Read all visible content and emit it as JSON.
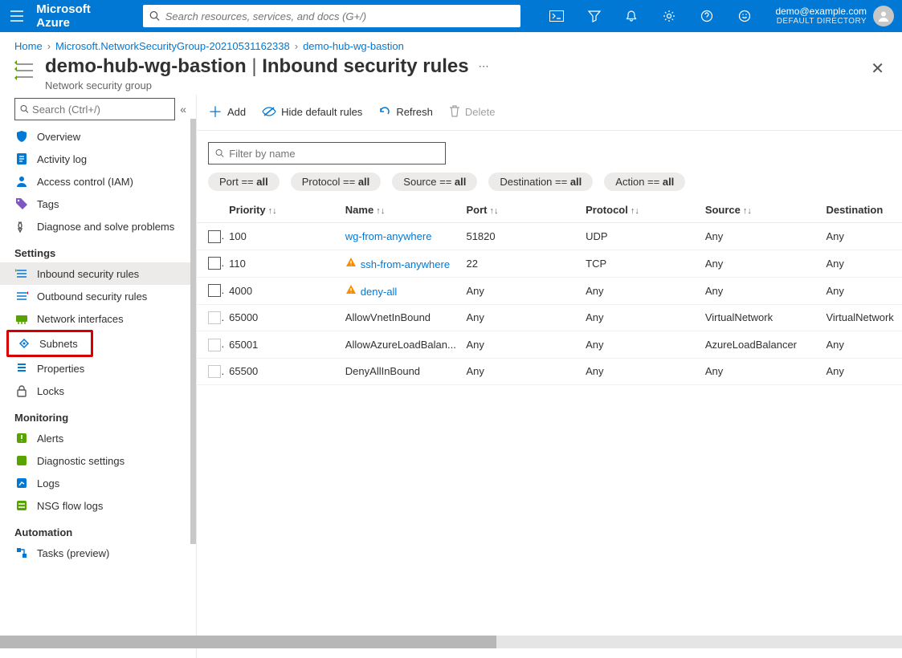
{
  "header": {
    "brand": "Microsoft Azure",
    "search_placeholder": "Search resources, services, and docs (G+/)",
    "account_email": "demo@example.com",
    "account_dir": "DEFAULT DIRECTORY"
  },
  "breadcrumb": {
    "home": "Home",
    "group": "Microsoft.NetworkSecurityGroup-20210531162338",
    "resource": "demo-hub-wg-bastion"
  },
  "page": {
    "title_left": "demo-hub-wg-bastion",
    "title_right": "Inbound security rules",
    "subtitle": "Network security group",
    "search_placeholder": "Search (Ctrl+/)"
  },
  "sidebar": {
    "items_top": [
      {
        "icon": "shield",
        "label": "Overview"
      },
      {
        "icon": "log",
        "label": "Activity log"
      },
      {
        "icon": "person",
        "label": "Access control (IAM)"
      },
      {
        "icon": "tag",
        "label": "Tags"
      },
      {
        "icon": "diag",
        "label": "Diagnose and solve problems"
      }
    ],
    "sect_settings": "Settings",
    "items_settings": [
      {
        "icon": "inbound",
        "label": "Inbound security rules",
        "active": true
      },
      {
        "icon": "outbound",
        "label": "Outbound security rules"
      },
      {
        "icon": "nic",
        "label": "Network interfaces"
      },
      {
        "icon": "subnet",
        "label": "Subnets",
        "highlight": true
      },
      {
        "icon": "props",
        "label": "Properties"
      },
      {
        "icon": "lock",
        "label": "Locks"
      }
    ],
    "sect_monitoring": "Monitoring",
    "items_monitoring": [
      {
        "icon": "alert",
        "label": "Alerts"
      },
      {
        "icon": "diagset",
        "label": "Diagnostic settings"
      },
      {
        "icon": "logs",
        "label": "Logs"
      },
      {
        "icon": "flow",
        "label": "NSG flow logs"
      }
    ],
    "sect_automation": "Automation",
    "items_automation": [
      {
        "icon": "tasks",
        "label": "Tasks (preview)"
      }
    ]
  },
  "toolbar": {
    "add": "Add",
    "hide": "Hide default rules",
    "refresh": "Refresh",
    "delete": "Delete"
  },
  "filter": {
    "placeholder": "Filter by name",
    "pills": [
      {
        "label": "Port",
        "value": "all"
      },
      {
        "label": "Protocol",
        "value": "all"
      },
      {
        "label": "Source",
        "value": "all"
      },
      {
        "label": "Destination",
        "value": "all"
      },
      {
        "label": "Action",
        "value": "all"
      }
    ]
  },
  "table": {
    "cols": [
      "Priority",
      "Name",
      "Port",
      "Protocol",
      "Source",
      "Destination"
    ],
    "rows": [
      {
        "priority": "100",
        "name": "wg-from-anywhere",
        "port": "51820",
        "protocol": "UDP",
        "source": "Any",
        "dest": "Any",
        "link": true,
        "warn": false,
        "enabled": true
      },
      {
        "priority": "110",
        "name": "ssh-from-anywhere",
        "port": "22",
        "protocol": "TCP",
        "source": "Any",
        "dest": "Any",
        "link": true,
        "warn": true,
        "enabled": true
      },
      {
        "priority": "4000",
        "name": "deny-all",
        "port": "Any",
        "protocol": "Any",
        "source": "Any",
        "dest": "Any",
        "link": true,
        "warn": true,
        "enabled": true
      },
      {
        "priority": "65000",
        "name": "AllowVnetInBound",
        "port": "Any",
        "protocol": "Any",
        "source": "VirtualNetwork",
        "dest": "VirtualNetwork",
        "link": false,
        "warn": false,
        "enabled": false
      },
      {
        "priority": "65001",
        "name": "AllowAzureLoadBalan...",
        "port": "Any",
        "protocol": "Any",
        "source": "AzureLoadBalancer",
        "dest": "Any",
        "link": false,
        "warn": false,
        "enabled": false
      },
      {
        "priority": "65500",
        "name": "DenyAllInBound",
        "port": "Any",
        "protocol": "Any",
        "source": "Any",
        "dest": "Any",
        "link": false,
        "warn": false,
        "enabled": false
      }
    ]
  }
}
